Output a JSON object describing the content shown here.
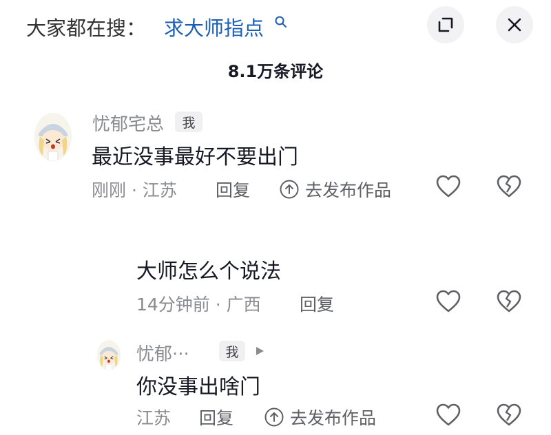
{
  "header": {
    "search_prefix": "大家都在搜：",
    "search_term": "求大师指点",
    "comment_count": "8.1万条评论"
  },
  "comments": [
    {
      "username": "忧郁宅总",
      "me_badge": "我",
      "text": "最近没事最好不要出门",
      "time": "刚刚",
      "location": "江苏",
      "meta": "刚刚 · 江苏",
      "reply_label": "回复",
      "publish_label": "去发布作品"
    }
  ],
  "replies": [
    {
      "text": "大师怎么个说法",
      "meta": "14分钟前 · 广西",
      "reply_label": "回复"
    },
    {
      "username": "忧郁···",
      "me_badge": "我",
      "text": "你没事出啥门",
      "meta": "江苏",
      "reply_label": "回复",
      "publish_label": "去发布作品"
    }
  ],
  "colors": {
    "link": "#1a5fb4",
    "text": "#161823",
    "muted": "#8a8b91",
    "button_bg": "#f2f2f4"
  },
  "icons": [
    "search-icon",
    "expand-icon",
    "close-icon",
    "heart-icon",
    "broken-heart-icon",
    "share-arrow-icon",
    "play-arrow-icon"
  ]
}
